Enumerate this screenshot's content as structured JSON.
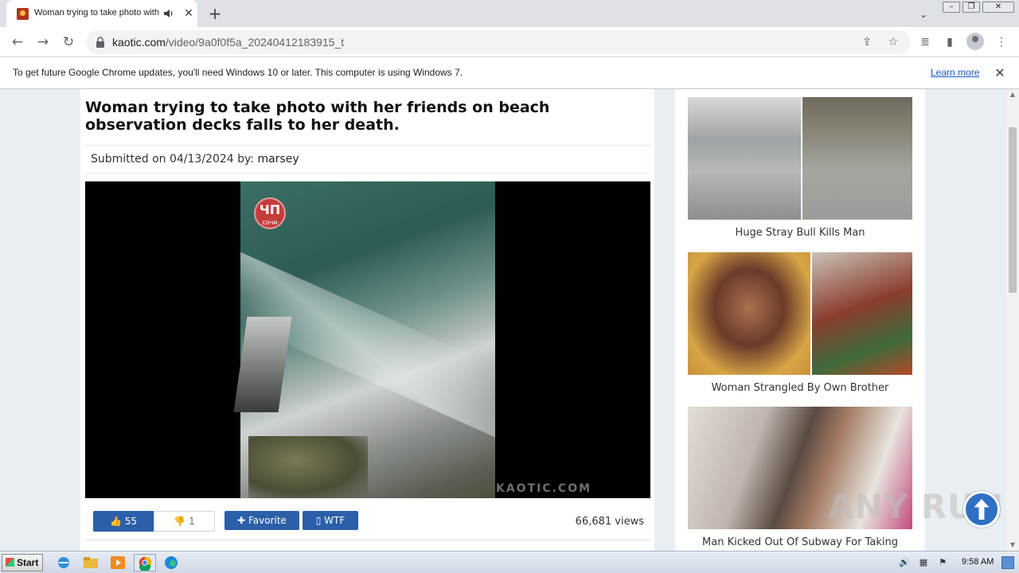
{
  "browser": {
    "tab_title": "Woman trying to take photo with",
    "url_domain": "kaotic.com",
    "url_path": "/video/9a0f0f5a_20240412183915_t",
    "infobar_text": "To get future Google Chrome updates, you'll need Windows 10 or later. This computer is using Windows 7.",
    "infobar_link": "Learn more"
  },
  "video": {
    "title": "Woman trying to take photo with her friends on beach observation decks falls to her death.",
    "submitted_prefix": "Submitted on 04/13/2024 by:",
    "submitted_user": "marsey",
    "watermark": "KAOTIC.COM",
    "logo_text": "сочи",
    "likes": "55",
    "dislikes": "1",
    "favorite_label": "Favorite",
    "wtf_label": "WTF",
    "views": "66,681 views"
  },
  "sidebar": {
    "items": [
      {
        "title": "Huge Stray Bull Kills Man"
      },
      {
        "title": "Woman Strangled By Own Brother"
      },
      {
        "title": "Man Kicked Out Of Subway For Taking"
      }
    ]
  },
  "overlay": {
    "brand": "ANY RUN"
  },
  "taskbar": {
    "start_label": "Start",
    "clock": "9:58 AM"
  },
  "colors": {
    "accent": "#2b5fa8",
    "link": "#1a56c9",
    "page_bg": "#e9eef2"
  }
}
